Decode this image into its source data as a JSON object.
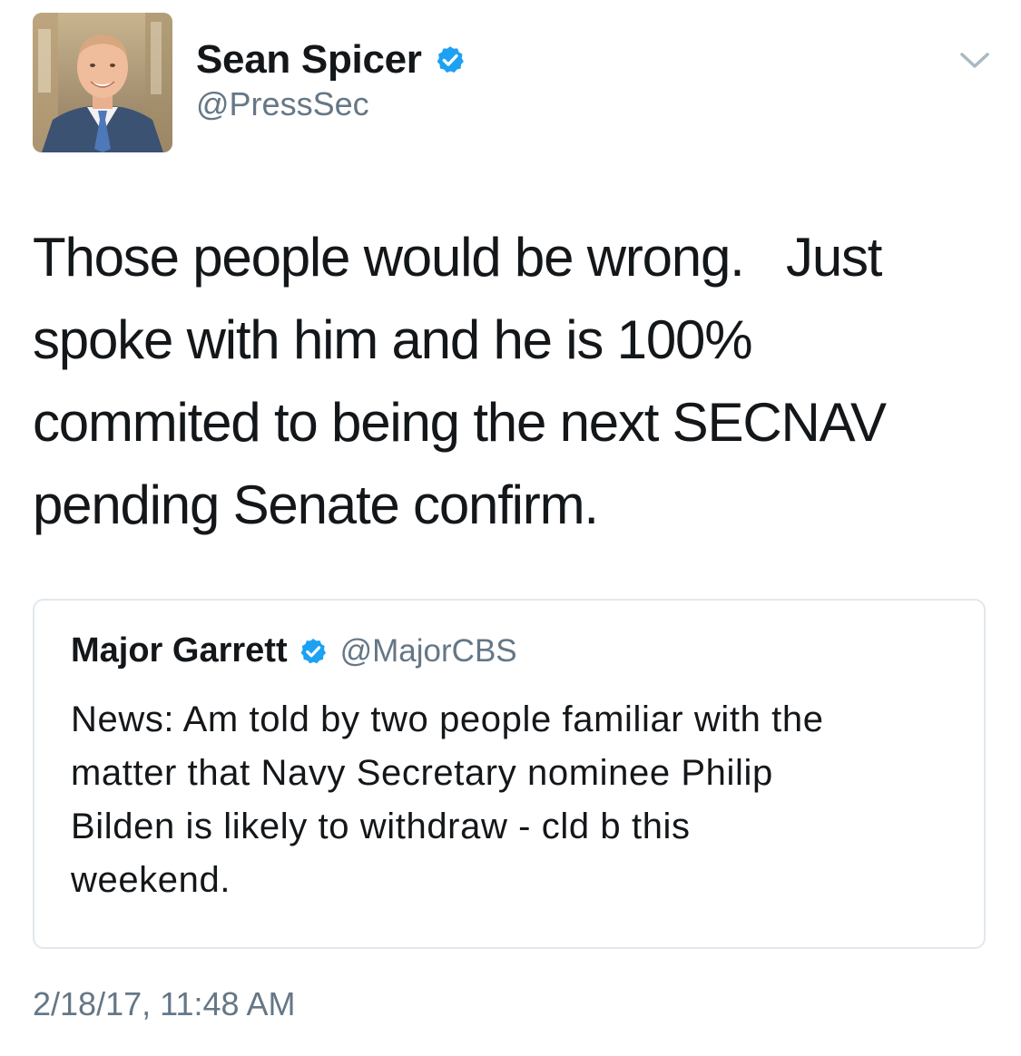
{
  "author": {
    "name": "Sean Spicer",
    "handle": "@PressSec",
    "verified": true,
    "avatar_icon": "profile-photo"
  },
  "tweet": {
    "text": "Those people would be wrong.   Just\nspoke with him and he is 100%\ncommited to being the next SECNAV\npending Senate confirm.",
    "timestamp": "2/18/17, 11:48 AM"
  },
  "quoted_tweet": {
    "name": "Major Garrett",
    "handle": "@MajorCBS",
    "verified": true,
    "text": "News: Am told by two people familiar with the\nmatter that Navy Secretary nominee Philip\nBilden is likely to withdraw - cld b this\nweekend."
  },
  "icons": {
    "verified": "verified-badge-icon",
    "menu": "chevron-down-icon"
  },
  "colors": {
    "verified_blue": "#1da1f2",
    "secondary_text": "#657786",
    "primary_text": "#14171a",
    "card_border": "#e1e8ed"
  }
}
